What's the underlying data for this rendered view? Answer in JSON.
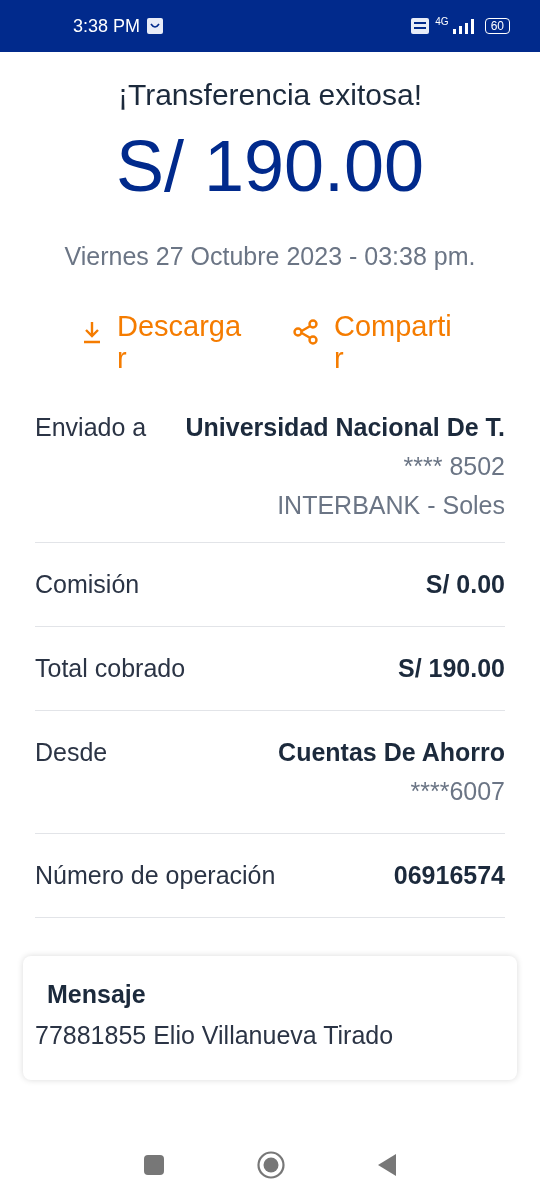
{
  "status_bar": {
    "time": "3:38 PM",
    "network": "4G",
    "battery": "60"
  },
  "title": "¡Transferencia exitosa!",
  "amount": "S/ 190.00",
  "date": "Viernes 27 Octubre 2023 - 03:38 pm.",
  "actions": [
    {
      "kind": "download",
      "label": "Descargar"
    },
    {
      "kind": "share",
      "label": "Compartir"
    }
  ],
  "recipient": {
    "label": "Enviado a",
    "name": "Universidad Nacional De T.",
    "account": "**** 8502",
    "bank": "INTERBANK - Soles"
  },
  "details": [
    {
      "label": "Comisión",
      "lines": [
        "S/ 0.00"
      ]
    },
    {
      "label": "Total cobrado",
      "lines": [
        "S/ 190.00"
      ]
    },
    {
      "label": "Desde",
      "lines": [
        "Cuentas De Ahorro",
        "****6007"
      ]
    },
    {
      "label": "Número de operación",
      "lines": [
        "06916574"
      ]
    }
  ],
  "message": {
    "title": "Mensaje",
    "text": "77881855 Elio Villanueva Tirado"
  }
}
